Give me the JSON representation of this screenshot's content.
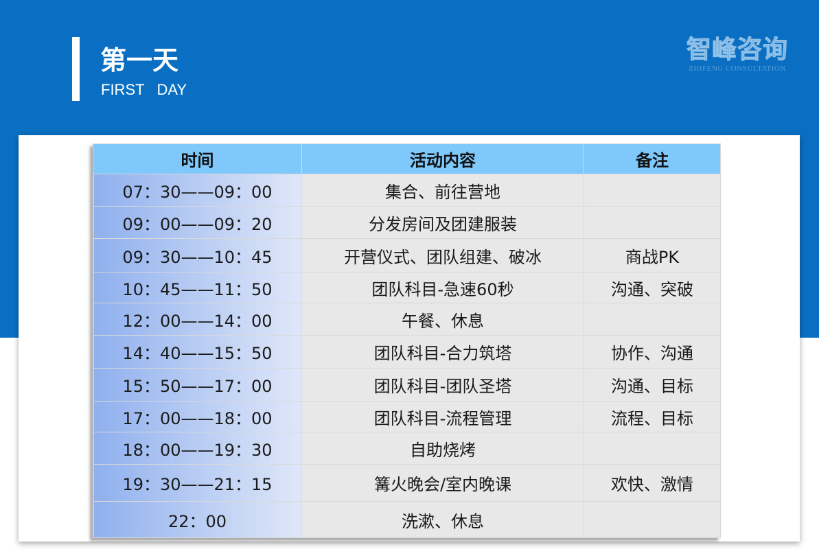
{
  "header": {
    "title": "第一天",
    "subtitle": "FIRST   DAY"
  },
  "logo": {
    "main": "智峰咨询",
    "sub": "ZHIFENG CONSULTATION"
  },
  "table": {
    "headers": {
      "time": "时间",
      "activity": "活动内容",
      "note": "备注"
    },
    "rows": [
      {
        "time": "07：30——09：00",
        "activity": "集合、前往营地",
        "note": ""
      },
      {
        "time": "09：00——09：20",
        "activity": "分发房间及团建服装",
        "note": ""
      },
      {
        "time": "09：30——10：45",
        "activity": "开营仪式、团队组建、破冰",
        "note": "商战PK"
      },
      {
        "time": "10：45——11：50",
        "activity": "团队科目-急速60秒",
        "note": "沟通、突破"
      },
      {
        "time": "12：00——14：00",
        "activity": "午餐、休息",
        "note": ""
      },
      {
        "time": "14：40——15：50",
        "activity": "团队科目-合力筑塔",
        "note": "协作、沟通"
      },
      {
        "time": "15：50——17：00",
        "activity": "团队科目-团队圣塔",
        "note": "沟通、目标"
      },
      {
        "time": "17：00——18：00",
        "activity": "团队科目-流程管理",
        "note": "流程、目标"
      },
      {
        "time": "18：00——19：30",
        "activity": "自助烧烤",
        "note": ""
      },
      {
        "time": "19：30——21：15",
        "activity": "篝火晚会/室内晚课",
        "note": "欢快、激情"
      },
      {
        "time": "22：00",
        "activity": "洗漱、休息",
        "note": ""
      }
    ]
  },
  "colors": {
    "banner": "#0a6fc2",
    "table_header": "#7ec8fb",
    "time_cell_gradient_start": "#8fb0ee",
    "time_cell_gradient_end": "#dfe7f9",
    "body_cell": "#e8e8e8"
  }
}
